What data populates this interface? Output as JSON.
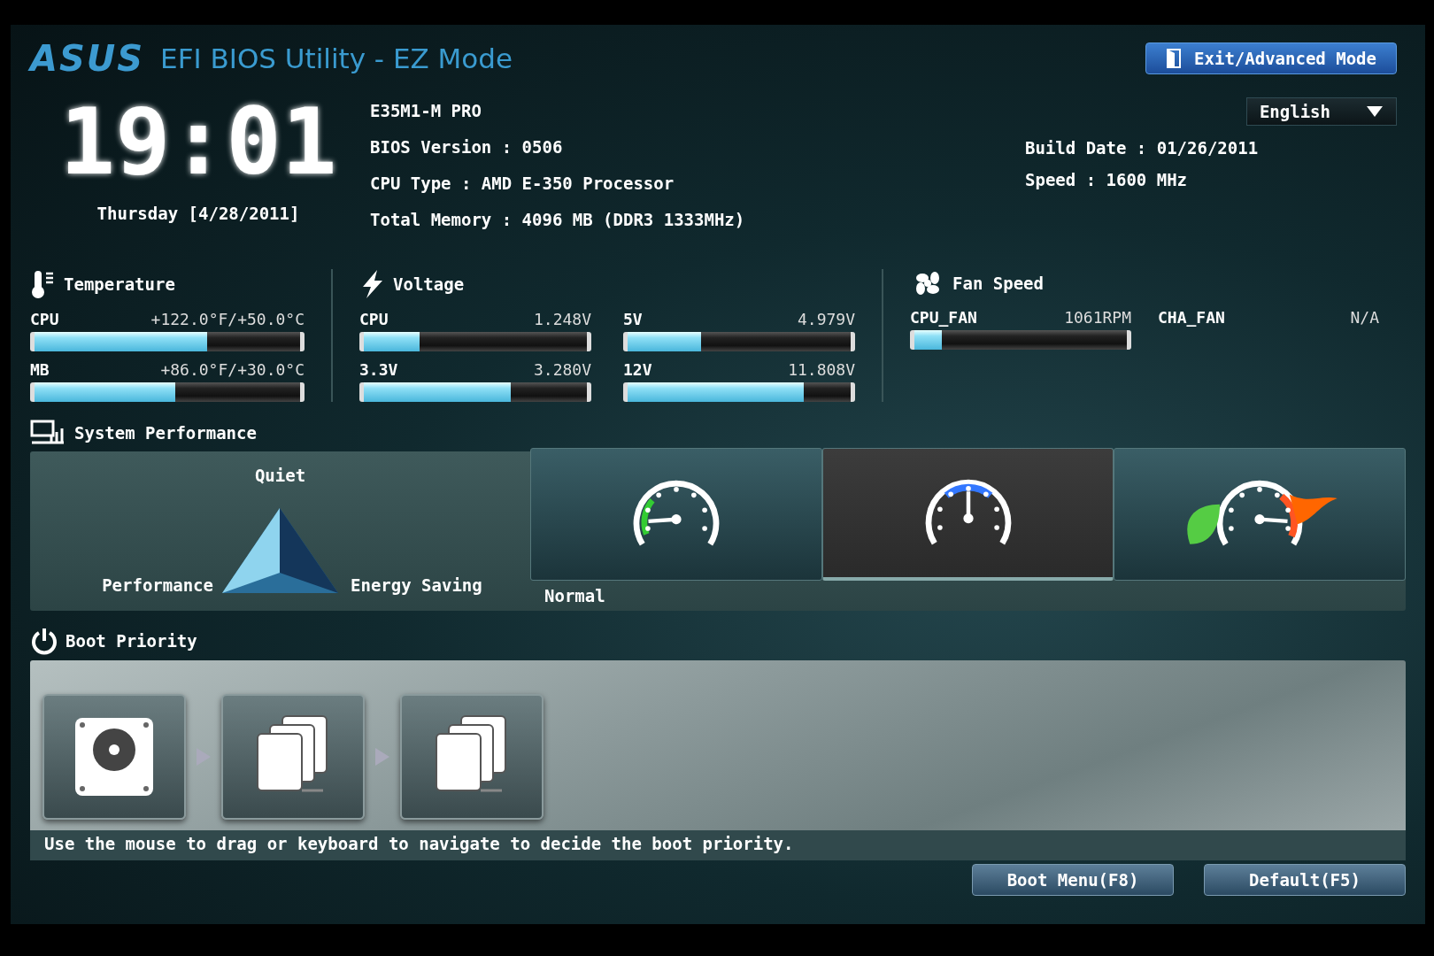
{
  "header": {
    "logo": "ASUS",
    "title": "EFI BIOS Utility - EZ Mode",
    "exit_button": "Exit/Advanced Mode"
  },
  "clock": {
    "time": "19:01",
    "date": "Thursday [4/28/2011]"
  },
  "system_info": [
    "E35M1-M PRO",
    "BIOS Version : 0506",
    "CPU Type : AMD E-350 Processor",
    "Total Memory : 4096 MB (DDR3 1333MHz)"
  ],
  "language": {
    "value": "English"
  },
  "build_info": [
    "Build Date : 01/26/2011",
    "Speed : 1600 MHz"
  ],
  "temperature": {
    "title": "Temperature",
    "sensors": [
      {
        "name": "CPU",
        "reading": "+122.0°F/+50.0°C",
        "level": 0.65
      },
      {
        "name": "MB",
        "reading": "+86.0°F/+30.0°C",
        "level": 0.53
      }
    ]
  },
  "voltage": {
    "title": "Voltage",
    "sensors": [
      {
        "name": "CPU",
        "reading": "1.248V",
        "level": 0.25
      },
      {
        "name": "5V",
        "reading": "4.979V",
        "level": 0.33
      },
      {
        "name": "3.3V",
        "reading": "3.280V",
        "level": 0.66
      },
      {
        "name": "12V",
        "reading": "11.808V",
        "level": 0.79
      }
    ]
  },
  "fan_speed": {
    "title": "Fan Speed",
    "fans": [
      {
        "kind": "bar",
        "name": "CPU_FAN",
        "reading": "1061RPM",
        "level": 0.13
      },
      {
        "kind": "text",
        "name": "CHA_FAN",
        "reading": "N/A"
      }
    ]
  },
  "performance": {
    "title": "System Performance",
    "triangle_labels": {
      "top": "Quiet",
      "left": "Performance",
      "right": "Energy Saving"
    },
    "modes": [
      {
        "kind": "quiet",
        "selected": false
      },
      {
        "kind": "normal",
        "selected": true
      },
      {
        "kind": "turbo",
        "selected": false
      }
    ],
    "mode_label": "Normal"
  },
  "boot_priority": {
    "title": "Boot Priority",
    "devices": [
      {
        "kind": "hard-disk"
      },
      {
        "kind": "drive-stack"
      },
      {
        "kind": "drive-stack"
      }
    ],
    "hint": "Use the mouse to drag or keyboard to navigate to decide the boot priority."
  },
  "buttons": [
    "Boot Menu(F8)",
    "Default(F5)"
  ]
}
